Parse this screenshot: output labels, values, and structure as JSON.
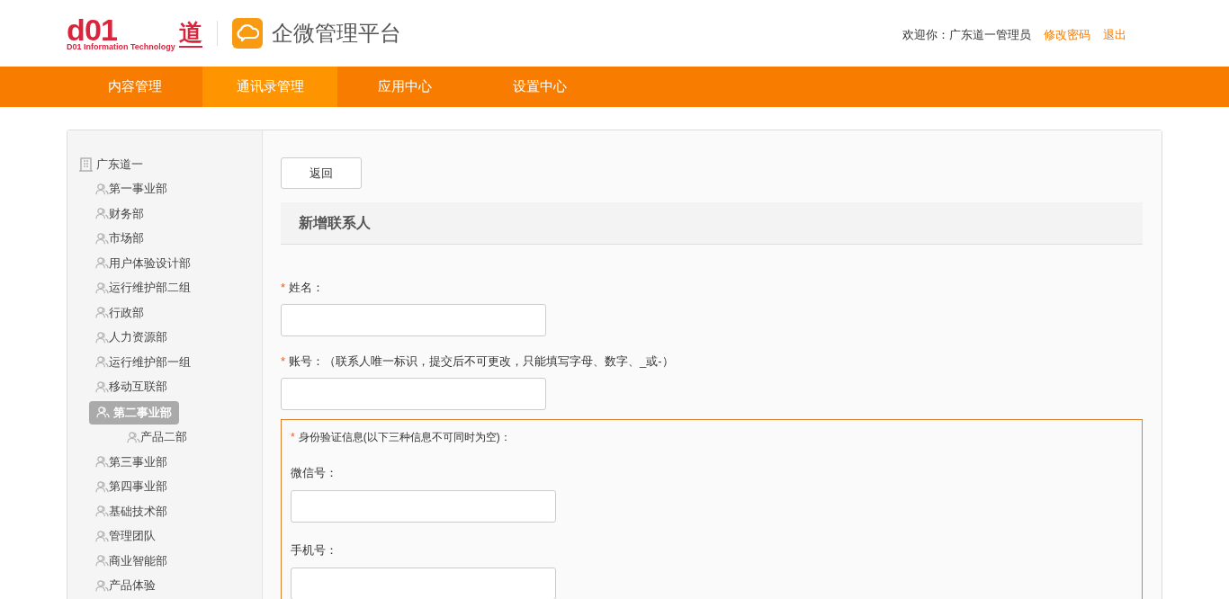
{
  "header": {
    "logo": {
      "mark": "d01",
      "char": "道",
      "tagline": "D01 Information Technology"
    },
    "app_title": "企微管理平台",
    "welcome": "欢迎你：广东道一管理员",
    "links": [
      "修改密码",
      "退出"
    ]
  },
  "nav": [
    {
      "label": "内容管理",
      "selected": false
    },
    {
      "label": "通讯录管理",
      "selected": true
    },
    {
      "label": "应用中心",
      "selected": false
    },
    {
      "label": "设置中心",
      "selected": false
    }
  ],
  "tree": {
    "label": "广东道一",
    "children": [
      {
        "label": "第一事业部",
        "selected": false
      },
      {
        "label": "财务部",
        "selected": false
      },
      {
        "label": "市场部",
        "selected": false
      },
      {
        "label": "用户体验设计部",
        "selected": false
      },
      {
        "label": "运行维护部二组",
        "selected": false
      },
      {
        "label": "行政部",
        "selected": false
      },
      {
        "label": "人力资源部",
        "selected": false
      },
      {
        "label": "运行维护部一组",
        "selected": false
      },
      {
        "label": "移动互联部",
        "selected": false
      },
      {
        "label": "第二事业部",
        "selected": true,
        "children": [
          {
            "label": "产品二部",
            "selected": false
          }
        ]
      },
      {
        "label": "第三事业部",
        "selected": false
      },
      {
        "label": "第四事业部",
        "selected": false
      },
      {
        "label": "基础技术部",
        "selected": false
      },
      {
        "label": "管理团队",
        "selected": false
      },
      {
        "label": "商业智能部",
        "selected": false
      },
      {
        "label": "产品体验",
        "selected": false
      }
    ]
  },
  "back_button": "返回",
  "required_mark": "*",
  "section_title": "新增联系人",
  "fields": [
    {
      "label": "姓名：",
      "required": true
    },
    {
      "label": "账号：（联系人唯一标识，提交后不可更改，只能填写字母、数字、_或-）",
      "required": true
    }
  ],
  "identity": {
    "label": "身份验证信息(以下三种信息不可同时为空)：",
    "required": true,
    "fields": [
      {
        "label": "微信号："
      },
      {
        "label": "手机号："
      }
    ]
  }
}
